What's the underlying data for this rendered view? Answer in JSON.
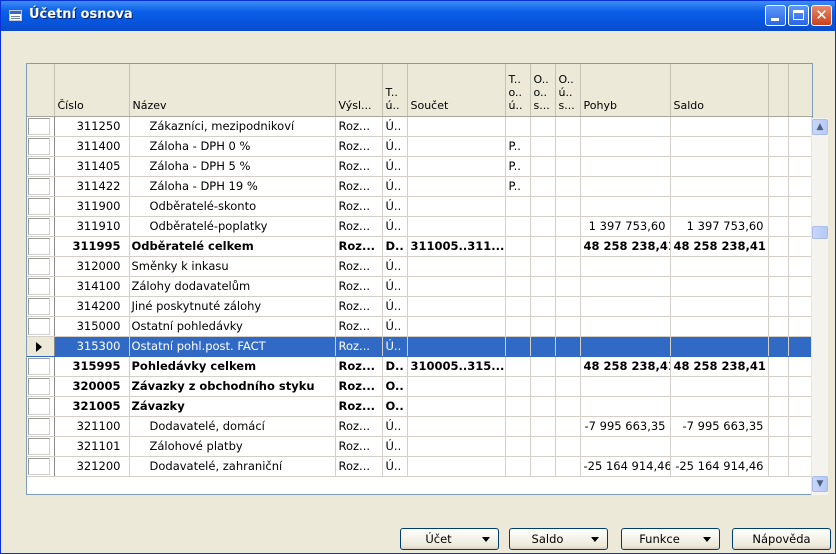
{
  "window": {
    "title": "Účetní osnova",
    "accent": "#0a5fe8",
    "selection_color": "#316ac5"
  },
  "columns": [
    {
      "key": "cislo",
      "label": "Číslo"
    },
    {
      "key": "nazev",
      "label": "Název"
    },
    {
      "key": "vysl",
      "label": "Výsl..."
    },
    {
      "key": "typ",
      "label": "T..\nú.."
    },
    {
      "key": "soucet",
      "label": "Součet"
    },
    {
      "key": "t2",
      "label": "T..\no..\nú.."
    },
    {
      "key": "o1",
      "label": "O..\no..\ns..."
    },
    {
      "key": "o2",
      "label": "O..\nú..\ns..."
    },
    {
      "key": "pohyb",
      "label": "Pohyb"
    },
    {
      "key": "saldo",
      "label": "Saldo"
    }
  ],
  "rows": [
    {
      "cislo": "311250",
      "nazev": "Zákazníci, mezipodnikoví",
      "vysl": "Roz...",
      "typ": "Ú..",
      "soucet": "",
      "t2": "",
      "pohyb": "",
      "saldo": "",
      "indent": 1
    },
    {
      "cislo": "311400",
      "nazev": "Záloha - DPH 0 %",
      "vysl": "Roz...",
      "typ": "Ú..",
      "soucet": "",
      "t2": "P..",
      "pohyb": "",
      "saldo": "",
      "indent": 1
    },
    {
      "cislo": "311405",
      "nazev": "Záloha - DPH 5 %",
      "vysl": "Roz...",
      "typ": "Ú..",
      "soucet": "",
      "t2": "P..",
      "pohyb": "",
      "saldo": "",
      "indent": 1
    },
    {
      "cislo": "311422",
      "nazev": "Záloha - DPH 19 %",
      "vysl": "Roz...",
      "typ": "Ú..",
      "soucet": "",
      "t2": "P..",
      "pohyb": "",
      "saldo": "",
      "indent": 1
    },
    {
      "cislo": "311900",
      "nazev": "Odběratelé-skonto",
      "vysl": "Roz...",
      "typ": "Ú..",
      "soucet": "",
      "t2": "",
      "pohyb": "",
      "saldo": "",
      "indent": 1
    },
    {
      "cislo": "311910",
      "nazev": "Odběratelé-poplatky",
      "vysl": "Roz...",
      "typ": "Ú..",
      "soucet": "",
      "t2": "",
      "pohyb": "1 397 753,60",
      "saldo": "1 397 753,60",
      "indent": 1
    },
    {
      "cislo": "311995",
      "nazev": "Odběratelé celkem",
      "vysl": "Roz...",
      "typ": "D..",
      "soucet": "311005..311...",
      "t2": "",
      "pohyb": "48 258 238,41",
      "saldo": "48 258 238,41",
      "indent": 0,
      "bold": true
    },
    {
      "cislo": "312000",
      "nazev": "Směnky k inkasu",
      "vysl": "Roz...",
      "typ": "Ú..",
      "soucet": "",
      "t2": "",
      "pohyb": "",
      "saldo": "",
      "indent": 0
    },
    {
      "cislo": "314100",
      "nazev": "Zálohy dodavatelům",
      "vysl": "Roz...",
      "typ": "Ú..",
      "soucet": "",
      "t2": "",
      "pohyb": "",
      "saldo": "",
      "indent": 0
    },
    {
      "cislo": "314200",
      "nazev": "Jiné poskytnuté zálohy",
      "vysl": "Roz...",
      "typ": "Ú..",
      "soucet": "",
      "t2": "",
      "pohyb": "",
      "saldo": "",
      "indent": 0
    },
    {
      "cislo": "315000",
      "nazev": "Ostatní pohledávky",
      "vysl": "Roz...",
      "typ": "Ú..",
      "soucet": "",
      "t2": "",
      "pohyb": "",
      "saldo": "",
      "indent": 0
    },
    {
      "cislo": "315300",
      "nazev": "Ostatní pohl.post. FACT",
      "vysl": "Roz...",
      "typ": "Ú..",
      "soucet": "",
      "t2": "",
      "pohyb": "",
      "saldo": "",
      "indent": 0,
      "selected": true
    },
    {
      "cislo": "315995",
      "nazev": "Pohledávky celkem",
      "vysl": "Roz...",
      "typ": "D..",
      "soucet": "310005..315...",
      "t2": "",
      "pohyb": "48 258 238,41",
      "saldo": "48 258 238,41",
      "indent": 0,
      "bold": true
    },
    {
      "cislo": "320005",
      "nazev": "Závazky z obchodního styku",
      "vysl": "Roz...",
      "typ": "O..",
      "soucet": "",
      "t2": "",
      "pohyb": "",
      "saldo": "",
      "indent": 0,
      "bold": true
    },
    {
      "cislo": "321005",
      "nazev": "Závazky",
      "vysl": "Roz...",
      "typ": "O..",
      "soucet": "",
      "t2": "",
      "pohyb": "",
      "saldo": "",
      "indent": 0,
      "bold": true
    },
    {
      "cislo": "321100",
      "nazev": "Dodavatelé, domácí",
      "vysl": "Roz...",
      "typ": "Ú..",
      "soucet": "",
      "t2": "",
      "pohyb": "-7 995 663,35",
      "saldo": "-7 995 663,35",
      "indent": 1
    },
    {
      "cislo": "321101",
      "nazev": "Zálohové platby",
      "vysl": "Roz...",
      "typ": "Ú..",
      "soucet": "",
      "t2": "",
      "pohyb": "",
      "saldo": "",
      "indent": 1
    },
    {
      "cislo": "321200",
      "nazev": "Dodavatelé, zahraniční",
      "vysl": "Roz...",
      "typ": "Ú..",
      "soucet": "",
      "t2": "",
      "pohyb": "-25 164 914,46",
      "saldo": "-25 164 914,46",
      "indent": 1
    }
  ],
  "buttons": {
    "ucet": "Účet",
    "saldo": "Saldo",
    "funkce": "Funkce",
    "napoveda": "Nápověda"
  }
}
